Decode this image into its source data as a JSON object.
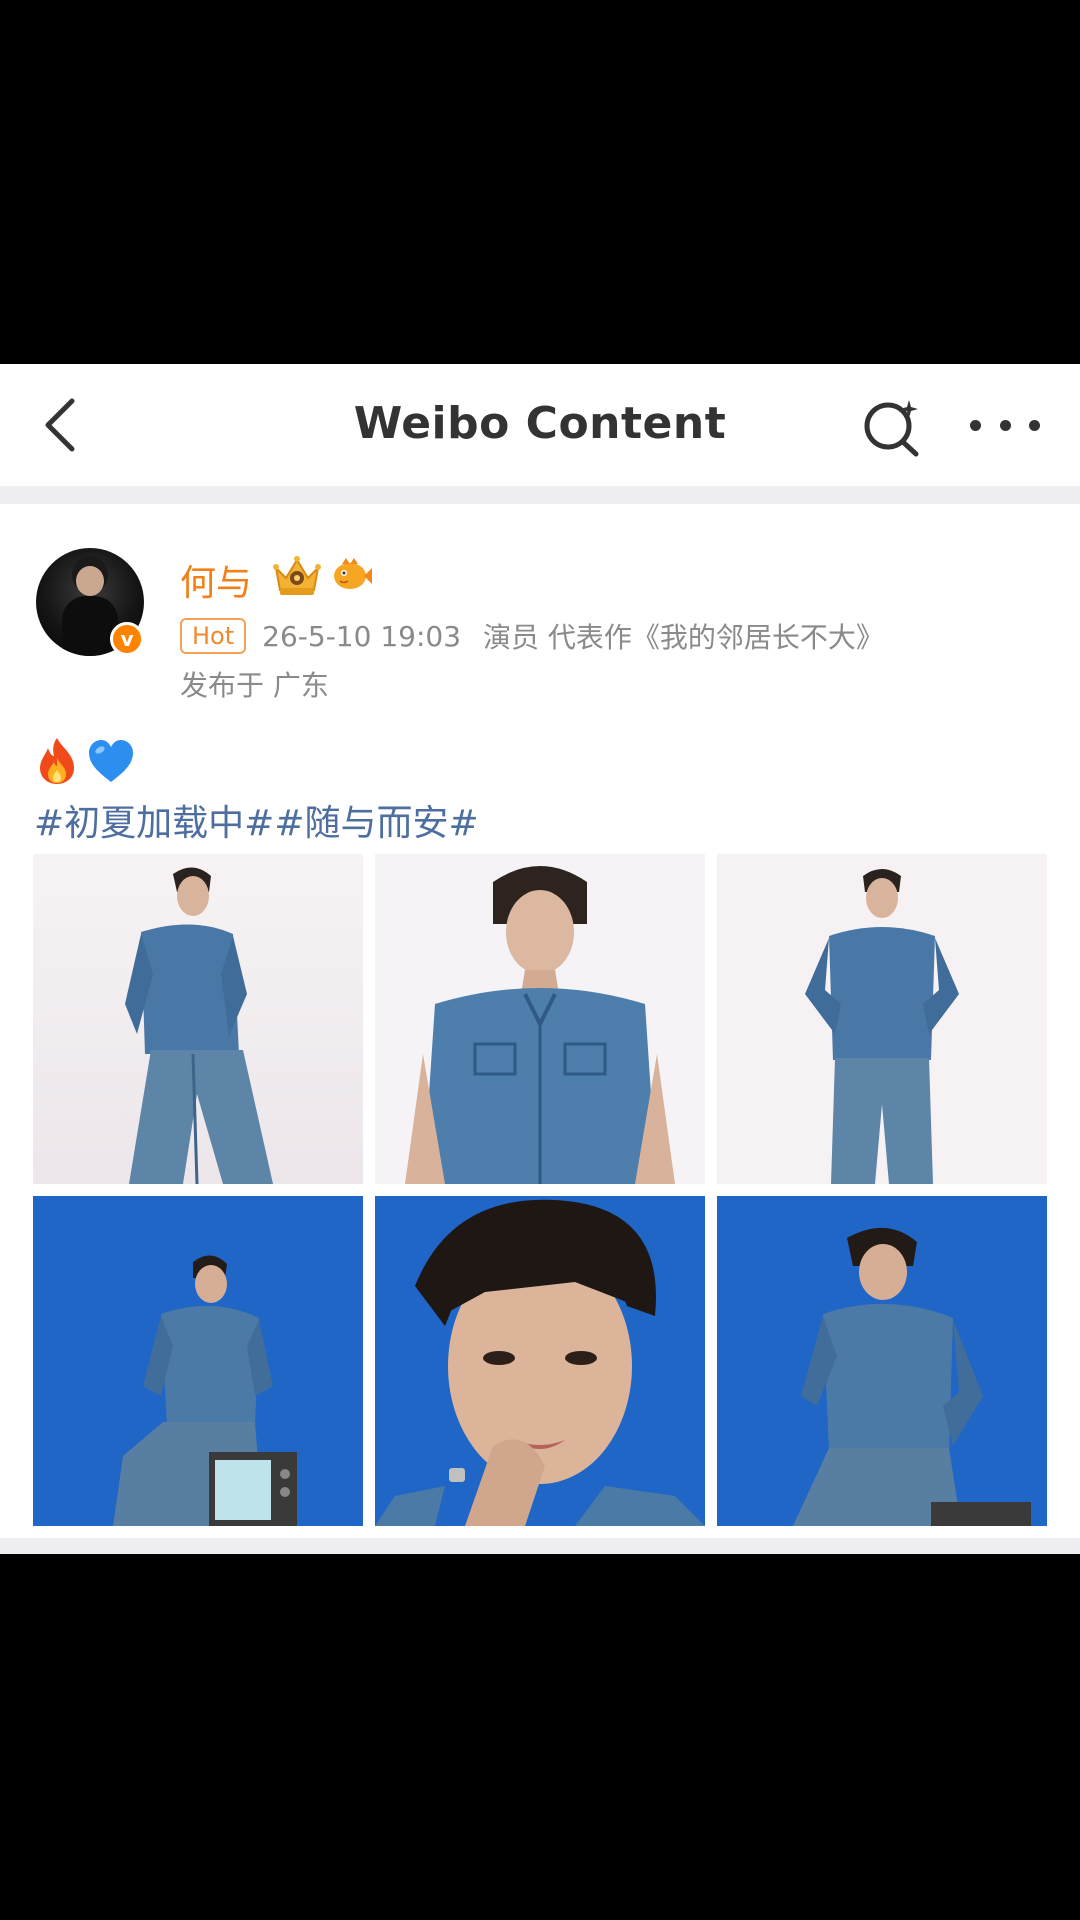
{
  "nav": {
    "title": "Weibo Content"
  },
  "post": {
    "username": "何与",
    "hot_label": "Hot",
    "time": "26-5-10 19:03",
    "description": "演员 代表作《我的邻居长不大》",
    "location": "发布于 广东",
    "verified_label": "v",
    "emojis": [
      "🔥",
      "💙"
    ],
    "hashtags": [
      "#初夏加载中#",
      "#随与而安#"
    ],
    "photos": [
      {
        "background": "light",
        "pose": "standing-lean"
      },
      {
        "background": "light",
        "pose": "half-body"
      },
      {
        "background": "light",
        "pose": "standing-hands-on-hips"
      },
      {
        "background": "blue",
        "pose": "seated-on-tv"
      },
      {
        "background": "blue",
        "pose": "face-closeup"
      },
      {
        "background": "blue",
        "pose": "seated-hand-on-hip"
      }
    ]
  },
  "colors": {
    "accent_orange": "#f37f16",
    "hashtag_blue": "#4e6ea0",
    "photo_blue": "#1d64c4",
    "denim": "#4a7aa8"
  }
}
